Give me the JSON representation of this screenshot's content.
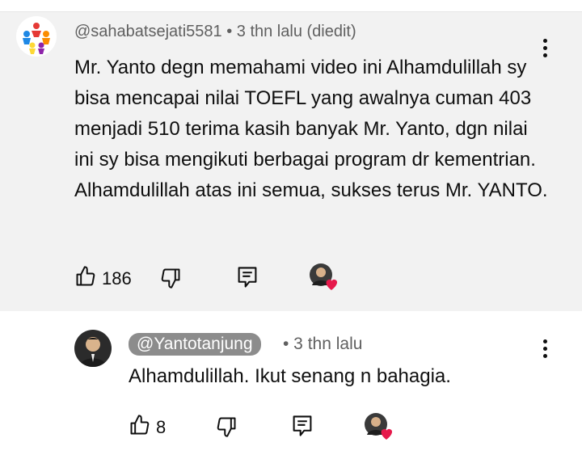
{
  "comment": {
    "handle_line": "@sahabatsejati5581 • 3 thn lalu (diedit)",
    "text": "Mr. Yanto degn memahami video ini Alhamdulillah sy bisa mencapai nilai TOEFL yang awalnya cuman 403 menjadi 510 terima kasih banyak Mr. Yanto, dgn nilai ini sy bisa mengikuti berbagai program dr kementrian. Alhamdulillah atas ini semua, sukses terus Mr. YANTO.",
    "like_count": "186"
  },
  "reply": {
    "handle": "@Yantotanjung",
    "time": "• 3 thn lalu",
    "text": "Alhamdulillah. Ikut senang n bahagia.",
    "like_count": "8"
  },
  "icons": {
    "like": "thumbs-up-icon",
    "dislike": "thumbs-down-icon",
    "reply": "reply-icon",
    "menu": "more-vertical-icon",
    "creator_heart": "creator-heart-icon"
  },
  "colors": {
    "heart": "#e6194b",
    "chip": "#8c8c8c"
  }
}
